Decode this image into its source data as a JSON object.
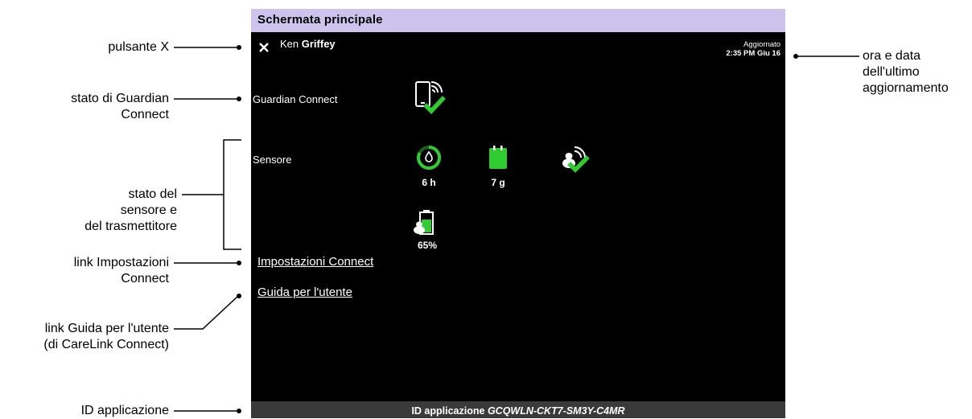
{
  "annotations": {
    "close_button": "pulsante X",
    "guardian_status": [
      "stato di Guardian",
      "Connect"
    ],
    "sensor_status": [
      "stato del",
      "sensore e",
      "del trasmettitore"
    ],
    "settings_link": [
      "link Impostazioni",
      "Connect"
    ],
    "guide_link": [
      "link Guida per l'utente",
      "(di CareLink Connect)"
    ],
    "app_id": "ID applicazione",
    "last_update": [
      "ora e data",
      "dell'ultimo",
      "aggiornamento"
    ]
  },
  "screen": {
    "title": "Schermata principale",
    "user_first": "Ken",
    "user_last": "Griffey",
    "updated_label": "Aggiornato",
    "updated_time": "2:35 PM Giu 16",
    "guardian_label": "Guardian Connect",
    "sensor_label": "Sensore",
    "sensor_life": "6 h",
    "transmitter_life": "7 g",
    "battery": "65%",
    "settings_link": "Impostazioni Connect",
    "guide_link": "Guida per l'utente",
    "app_id_label": "ID applicazione",
    "app_id": "GCQWLN-CKT7-SM3Y-C4MR"
  },
  "colors": {
    "titlebar": "#cec3ec",
    "status_green": "#2ecc2e",
    "footer": "#3a3a3a"
  }
}
